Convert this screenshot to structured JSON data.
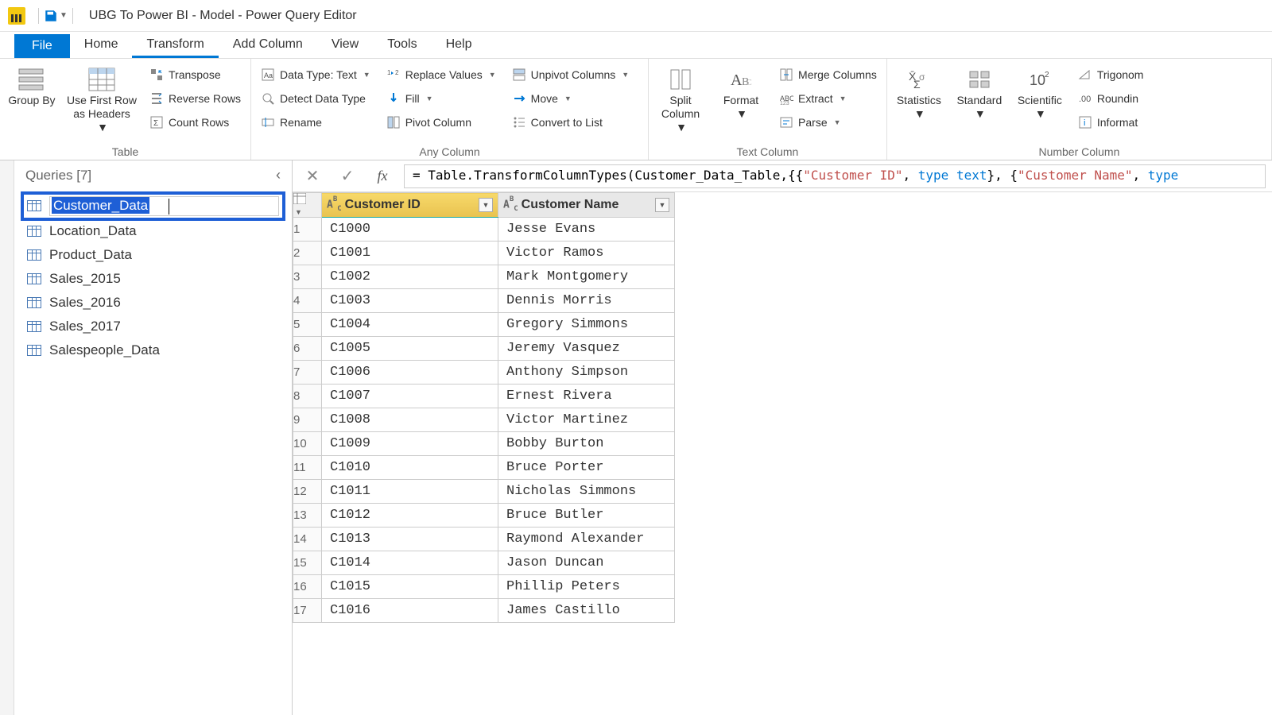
{
  "window": {
    "title": "UBG To Power BI - Model - Power Query Editor"
  },
  "tabs": {
    "file": "File",
    "items": [
      "Home",
      "Transform",
      "Add Column",
      "View",
      "Tools",
      "Help"
    ],
    "active_index": 1
  },
  "ribbon": {
    "table": {
      "group_label": "Table",
      "group_by": "Group By",
      "use_first_row": "Use First Row as Headers",
      "transpose": "Transpose",
      "reverse_rows": "Reverse Rows",
      "count_rows": "Count Rows"
    },
    "any_column": {
      "group_label": "Any Column",
      "data_type": "Data Type: Text",
      "detect": "Detect Data Type",
      "rename": "Rename",
      "replace": "Replace Values",
      "fill": "Fill",
      "pivot": "Pivot Column",
      "unpivot": "Unpivot Columns",
      "move": "Move",
      "convert_list": "Convert to List"
    },
    "text_column": {
      "group_label": "Text Column",
      "split": "Split Column",
      "format": "Format",
      "merge": "Merge Columns",
      "extract": "Extract",
      "parse": "Parse"
    },
    "number_column": {
      "group_label": "Number Column",
      "statistics": "Statistics",
      "standard": "Standard",
      "scientific": "Scientific",
      "trig": "Trigonom",
      "rounding": "Roundin",
      "info": "Informat"
    }
  },
  "queries": {
    "header": "Queries [7]",
    "editing_value": "Customer_Data",
    "items": [
      "Customer_Data",
      "Location_Data",
      "Product_Data",
      "Sales_2015",
      "Sales_2016",
      "Sales_2017",
      "Salespeople_Data"
    ]
  },
  "formula": {
    "prefix": "= Table.TransformColumnTypes(Customer_Data_Table,{{",
    "s1": "\"Customer ID\"",
    "mid1": ", ",
    "kw1": "type",
    "mid1b": " ",
    "kw2": "text",
    "mid2": "}, {",
    "s2": "\"Customer Name\"",
    "mid3": ", ",
    "kw3": "type"
  },
  "grid": {
    "columns": [
      "Customer ID",
      "Customer Name"
    ],
    "rows": [
      {
        "n": 1,
        "id": "C1000",
        "name": "Jesse Evans"
      },
      {
        "n": 2,
        "id": "C1001",
        "name": "Victor Ramos"
      },
      {
        "n": 3,
        "id": "C1002",
        "name": "Mark Montgomery"
      },
      {
        "n": 4,
        "id": "C1003",
        "name": "Dennis Morris"
      },
      {
        "n": 5,
        "id": "C1004",
        "name": "Gregory Simmons"
      },
      {
        "n": 6,
        "id": "C1005",
        "name": "Jeremy Vasquez"
      },
      {
        "n": 7,
        "id": "C1006",
        "name": "Anthony Simpson"
      },
      {
        "n": 8,
        "id": "C1007",
        "name": "Ernest Rivera"
      },
      {
        "n": 9,
        "id": "C1008",
        "name": "Victor Martinez"
      },
      {
        "n": 10,
        "id": "C1009",
        "name": "Bobby Burton"
      },
      {
        "n": 11,
        "id": "C1010",
        "name": "Bruce Porter"
      },
      {
        "n": 12,
        "id": "C1011",
        "name": "Nicholas Simmons"
      },
      {
        "n": 13,
        "id": "C1012",
        "name": "Bruce Butler"
      },
      {
        "n": 14,
        "id": "C1013",
        "name": "Raymond Alexander"
      },
      {
        "n": 15,
        "id": "C1014",
        "name": "Jason Duncan"
      },
      {
        "n": 16,
        "id": "C1015",
        "name": "Phillip Peters"
      },
      {
        "n": 17,
        "id": "C1016",
        "name": "James Castillo"
      }
    ]
  }
}
